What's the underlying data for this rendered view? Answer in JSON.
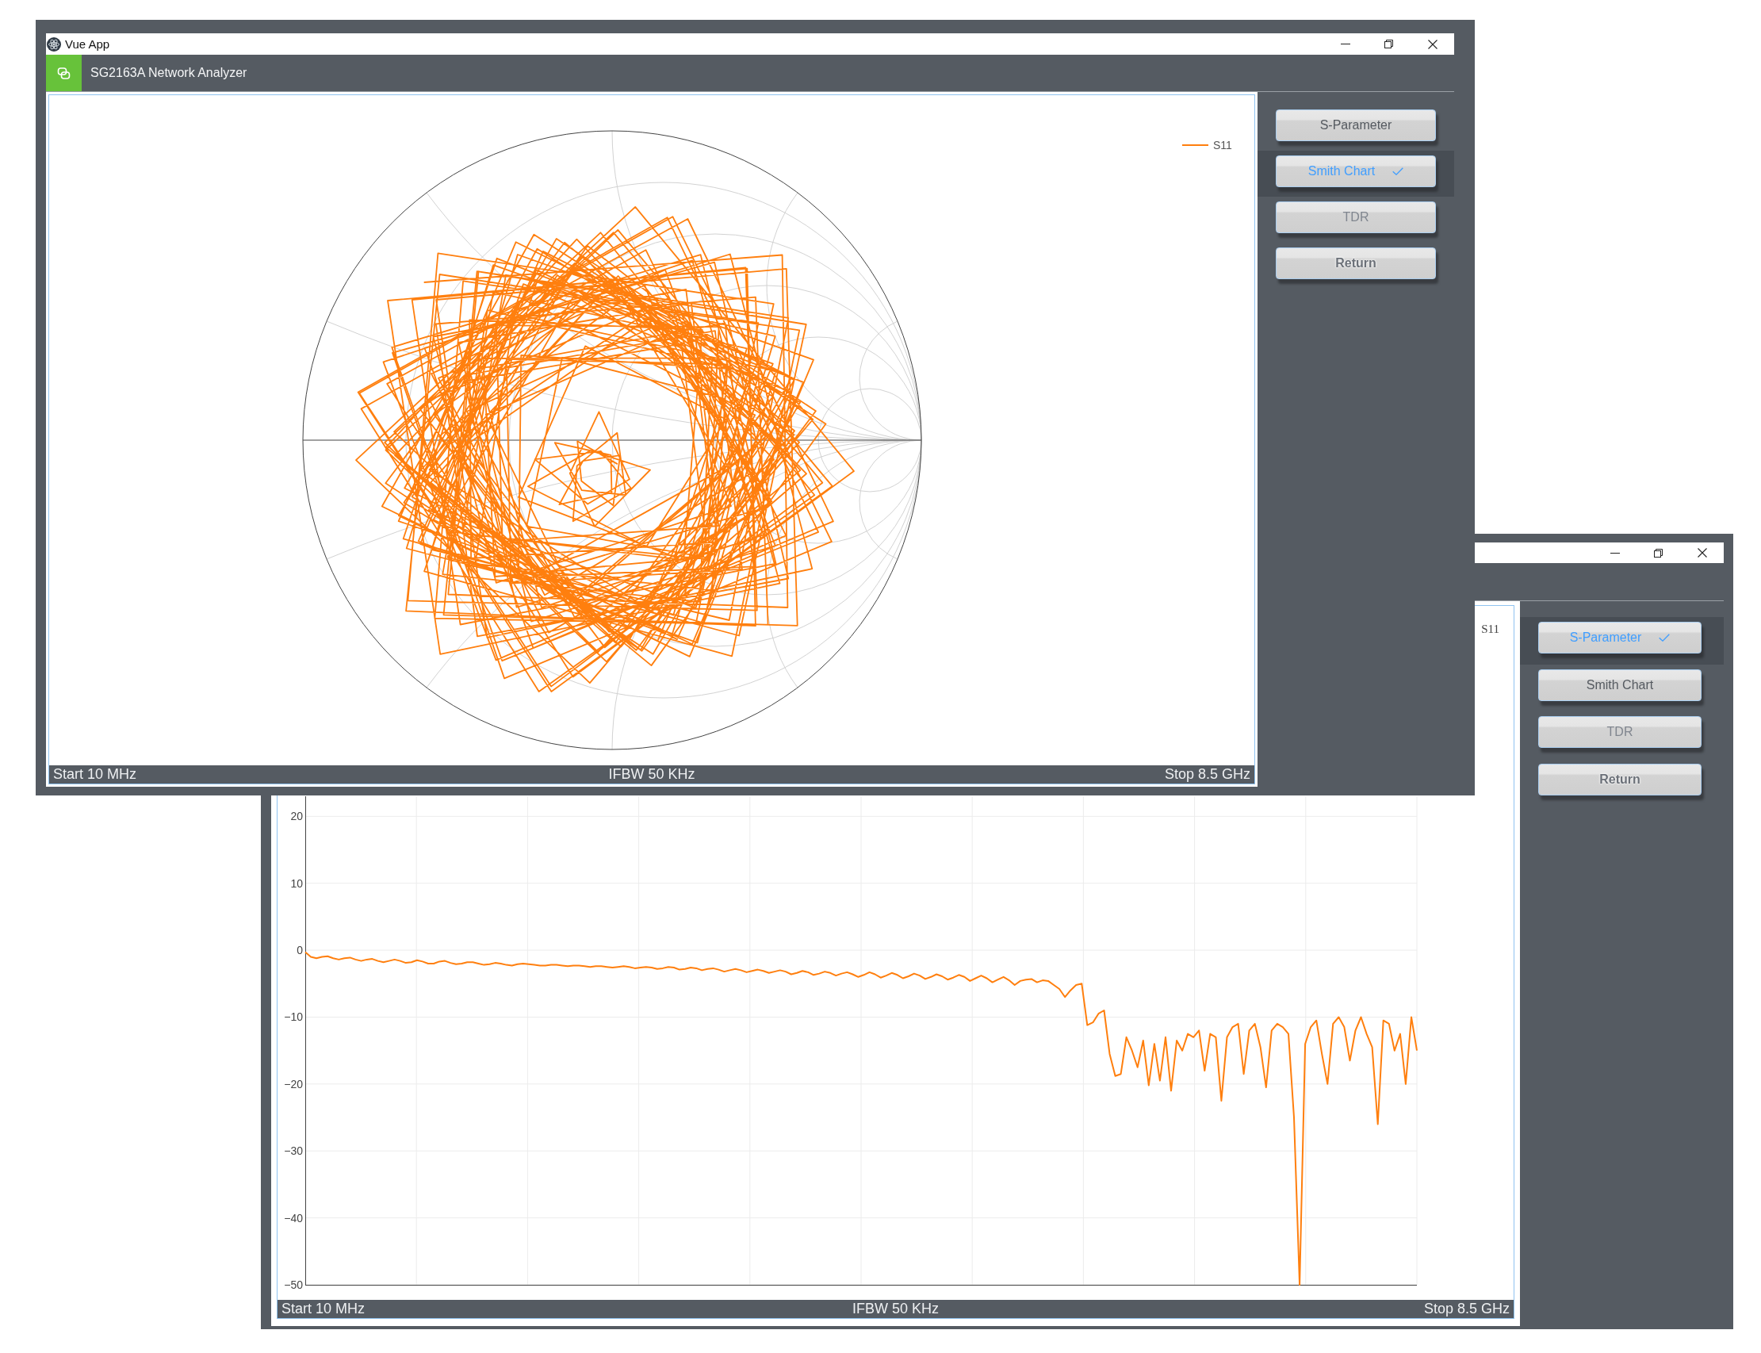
{
  "windows": [
    {
      "kind": "smith_chart",
      "on_top": true,
      "title_bar": {
        "title": "Vue App"
      },
      "header": {
        "title": "SG2163A Network Analyzer"
      },
      "plot": {
        "legend": [
          {
            "label": "S11"
          }
        ]
      },
      "buttons": [
        {
          "label": "S-Parameter",
          "kind": "mode",
          "selected": false,
          "disabled": false
        },
        {
          "label": "Smith Chart",
          "kind": "mode",
          "selected": true,
          "disabled": false
        },
        {
          "label": "TDR",
          "kind": "mode",
          "selected": false,
          "disabled": true
        },
        {
          "label": "Return",
          "kind": "action",
          "selected": false,
          "disabled": false
        }
      ],
      "status_bar": {
        "start": "Start 10 MHz",
        "ifbw": "IFBW 50 KHz",
        "stop": "Stop 8.5 GHz"
      }
    },
    {
      "kind": "s_parameter",
      "on_top": false,
      "plot": {
        "chart_data": {
          "type": "line",
          "grid": true,
          "ylim": [
            -50,
            23
          ],
          "yticks": [
            20,
            10,
            0,
            {
              "value": -10,
              "label": "−10"
            },
            {
              "value": -20,
              "label": "−20"
            },
            {
              "value": -30,
              "label": "−30"
            },
            {
              "value": -40,
              "label": "−40"
            },
            {
              "value": -50,
              "label": "−50"
            }
          ],
          "series": [
            {
              "name": "S11",
              "color": "#ff7f0e",
              "values": [
                -0.3,
                -1.0,
                -1.2,
                -1.0,
                -0.9,
                -1.2,
                -1.4,
                -1.2,
                -1.1,
                -1.4,
                -1.6,
                -1.4,
                -1.3,
                -1.6,
                -1.8,
                -1.6,
                -1.4,
                -1.6,
                -1.9,
                -1.8,
                -1.5,
                -1.7,
                -2.0,
                -2.0,
                -1.7,
                -1.6,
                -1.9,
                -2.1,
                -2.0,
                -1.8,
                -1.8,
                -2.0,
                -2.2,
                -2.1,
                -1.9,
                -2.0,
                -2.2,
                -2.3,
                -2.1,
                -2.0,
                -2.1,
                -2.2,
                -2.3,
                -2.3,
                -2.2,
                -2.2,
                -2.3,
                -2.4,
                -2.3,
                -2.3,
                -2.4,
                -2.5,
                -2.4,
                -2.4,
                -2.5,
                -2.6,
                -2.5,
                -2.4,
                -2.5,
                -2.7,
                -2.6,
                -2.5,
                -2.6,
                -2.8,
                -2.7,
                -2.5,
                -2.6,
                -2.9,
                -2.8,
                -2.6,
                -2.7,
                -3.0,
                -2.8,
                -2.7,
                -2.9,
                -3.2,
                -3.0,
                -2.8,
                -3.0,
                -3.3,
                -3.1,
                -2.9,
                -3.1,
                -3.4,
                -3.2,
                -3.0,
                -3.2,
                -3.6,
                -3.4,
                -3.1,
                -3.3,
                -3.7,
                -3.5,
                -3.2,
                -3.4,
                -3.8,
                -3.5,
                -3.3,
                -3.6,
                -4.0,
                -3.7,
                -3.3,
                -3.6,
                -4.1,
                -3.8,
                -3.4,
                -3.7,
                -4.2,
                -3.9,
                -3.5,
                -3.8,
                -4.3,
                -4.0,
                -3.6,
                -3.9,
                -4.4,
                -4.1,
                -3.7,
                -4.0,
                -4.6,
                -4.2,
                -3.8,
                -4.2,
                -4.8,
                -4.4,
                -4.0,
                -4.5,
                -5.2,
                -4.6,
                -4.4,
                -4.3,
                -4.8,
                -4.5,
                -4.6,
                -5.2,
                -5.8,
                -7.0,
                -6.0,
                -5.2,
                -5.0,
                -11.2,
                -10.8,
                -9.5,
                -9.0,
                -15.5,
                -18.8,
                -18.5,
                -13.0,
                -15.0,
                -17.5,
                -13.5,
                -20.2,
                -14.0,
                -19.5,
                -13.0,
                -21.0,
                -13.5,
                -15.0,
                -12.5,
                -13.0,
                -12.0,
                -18.0,
                -12.5,
                -13.0,
                -22.5,
                -13.0,
                -11.5,
                -11.0,
                -18.5,
                -12.0,
                -11.0,
                -14.5,
                -20.5,
                -12.0,
                -11.0,
                -11.5,
                -12.5,
                -25.0,
                -50.0,
                -14.0,
                -11.5,
                -10.5,
                -15.5,
                -20.0,
                -11.0,
                -10.0,
                -11.5,
                -16.5,
                -12.0,
                -10.0,
                -12.5,
                -14.5,
                -26.0,
                -10.5,
                -11.0,
                -15.0,
                -12.5,
                -20.0,
                -10.0,
                -15.0
              ]
            }
          ]
        }
      },
      "buttons": [
        {
          "label": "S-Parameter",
          "kind": "mode",
          "selected": true,
          "disabled": false
        },
        {
          "label": "Smith Chart",
          "kind": "mode",
          "selected": false,
          "disabled": false
        },
        {
          "label": "TDR",
          "kind": "mode",
          "selected": false,
          "disabled": true
        },
        {
          "label": "Return",
          "kind": "action",
          "selected": false,
          "disabled": false
        }
      ],
      "status_bar": {
        "start": "Start 10 MHz",
        "ifbw": "IFBW 50 KHz",
        "stop": "Stop 8.5 GHz"
      }
    }
  ]
}
